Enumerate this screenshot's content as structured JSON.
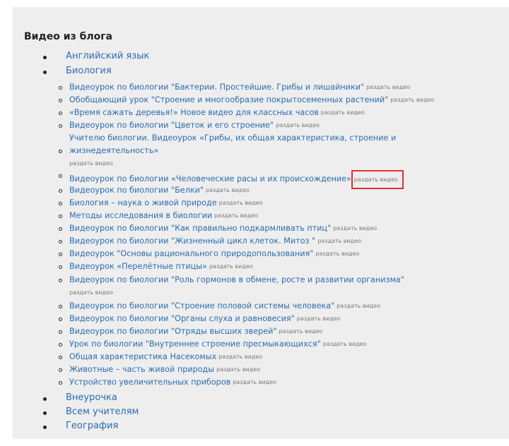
{
  "page": {
    "title": "Видео из блога",
    "share_label": "раздать видео"
  },
  "categories": [
    {
      "label": "Английский язык"
    },
    {
      "label": "Биология"
    },
    {
      "label": "Внеурочка"
    },
    {
      "label": "Всем учителям"
    },
    {
      "label": "География"
    }
  ],
  "biology_items": [
    {
      "title": "Видеоурок по биологии \"Бактерии. Простейшие. Грибы и лишайники\""
    },
    {
      "title": "Обобщающий урок \"Строение и многообразие покрытосеменных растений\""
    },
    {
      "title": "«Время сажать деревья!» Новое видео для классных часов"
    },
    {
      "title": "Видеоурок по биологии \"Цветок и его строение\""
    },
    {
      "title_line1": "Учителю биологии. Видеоурок «Грибы, их общая характеристика, строение и",
      "title_line2": "жизнедеятельность»"
    },
    {
      "title": "Видеоурок по биологии «Человеческие расы и их происхождение»"
    },
    {
      "title": "Видеоурок по биологии \"Белки\""
    },
    {
      "title": "Биология – наука о живой природе"
    },
    {
      "title": "Методы исследования в биологии"
    },
    {
      "title": "Видеоурок по биологии \"Как правильно подкармливать птиц\""
    },
    {
      "title": "Видеоурок по биологии \"Жизненный цикл клеток. Митоз \""
    },
    {
      "title": "Видеоурок \"Основы рационального природопользования\""
    },
    {
      "title": "Видеоурок «Перелётные птицы»"
    },
    {
      "title": "Видеоурок по биологии \"Роль гормонов в обмене, росте и развитии организма\""
    },
    {
      "title": "Видеоурок по биологии \"Строение половой системы человека\""
    },
    {
      "title": "Видеоурок по биологии \"Органы слуха и равновесия\""
    },
    {
      "title": "Видеоурок по биологии \"Отряды высших зверей\""
    },
    {
      "title": "Урок по биологии \"Внутреннее строение пресмыкающихся\""
    },
    {
      "title": "Общая характеристика Насекомых"
    },
    {
      "title": "Животные – часть живой природы"
    },
    {
      "title": "Устройство увеличительных приборов"
    }
  ],
  "colors": {
    "link": "#2b6cb0",
    "highlight_box": "#e03030",
    "frame_bg": "#eeeeee"
  }
}
